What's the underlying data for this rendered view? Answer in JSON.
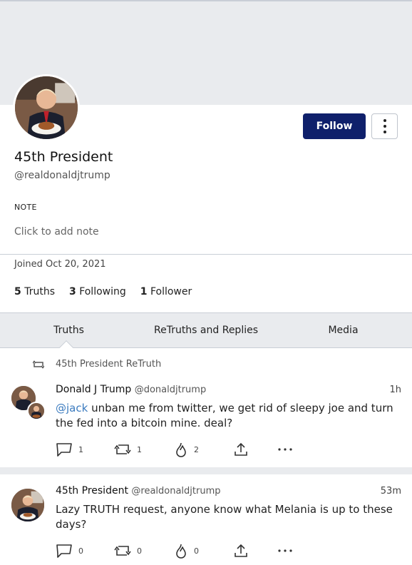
{
  "profile": {
    "display_name": "45th President",
    "handle": "@realdonaldjtrump",
    "follow_label": "Follow",
    "note_label": "NOTE",
    "note_placeholder": "Click to add note",
    "joined": "Joined Oct 20, 2021",
    "stats": {
      "truths_count": "5",
      "truths_label": "Truths",
      "following_count": "3",
      "following_label": "Following",
      "followers_count": "1",
      "followers_label": "Follower"
    }
  },
  "tabs": [
    {
      "label": "Truths",
      "active": true
    },
    {
      "label": "ReTruths and Replies",
      "active": false
    },
    {
      "label": "Media",
      "active": false
    }
  ],
  "posts": [
    {
      "retruth_by": "45th President ReTruth",
      "author": "Donald J Trump",
      "handle": "@donaldjtrump",
      "time": "1h",
      "mention": "@jack",
      "text": " unban me from twitter, we get rid of sleepy joe and turn the fed into a bitcoin mine. deal?",
      "replies": "1",
      "retruths": "1",
      "likes": "2"
    },
    {
      "author": "45th President",
      "handle": "@realdonaldjtrump",
      "time": "53m",
      "text": "Lazy TRUTH request, anyone know what Melania is up to these days?",
      "replies": "0",
      "retruths": "0",
      "likes": "0"
    }
  ],
  "colors": {
    "accent": "#0f206b",
    "link": "#3b7bbf",
    "banner": "#e9ebee"
  },
  "icons": [
    "more-vertical-icon",
    "retruth-icon",
    "reply-icon",
    "share-icon",
    "like-icon",
    "more-horizontal-icon"
  ]
}
